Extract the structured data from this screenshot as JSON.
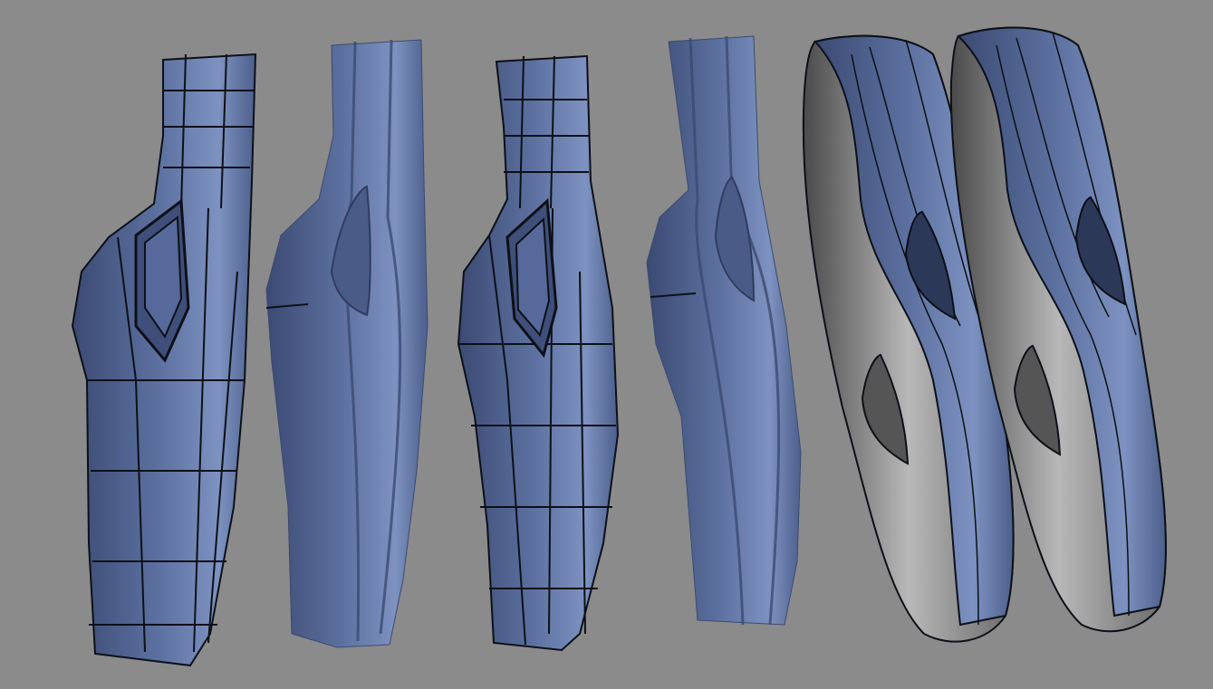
{
  "viewport": {
    "background_color": "#8b8b8b"
  },
  "palette": {
    "surface_base": "#5b6f9e",
    "surface_light": "#7d92c0",
    "surface_dark": "#3b4a72",
    "wire_color": "#0c1018",
    "inner_gray_light": "#b8b8b8",
    "inner_gray_dark": "#4a4a4a"
  },
  "models": [
    {
      "name": "strap-wireframe-low-poly-1",
      "style": "wireframe"
    },
    {
      "name": "strap-smooth-1",
      "style": "smooth"
    },
    {
      "name": "strap-wireframe-low-poly-2",
      "style": "wireframe"
    },
    {
      "name": "strap-smooth-2",
      "style": "smooth"
    },
    {
      "name": "strap-loop-wireframe-1",
      "style": "loop"
    },
    {
      "name": "strap-loop-wireframe-2",
      "style": "loop"
    }
  ]
}
